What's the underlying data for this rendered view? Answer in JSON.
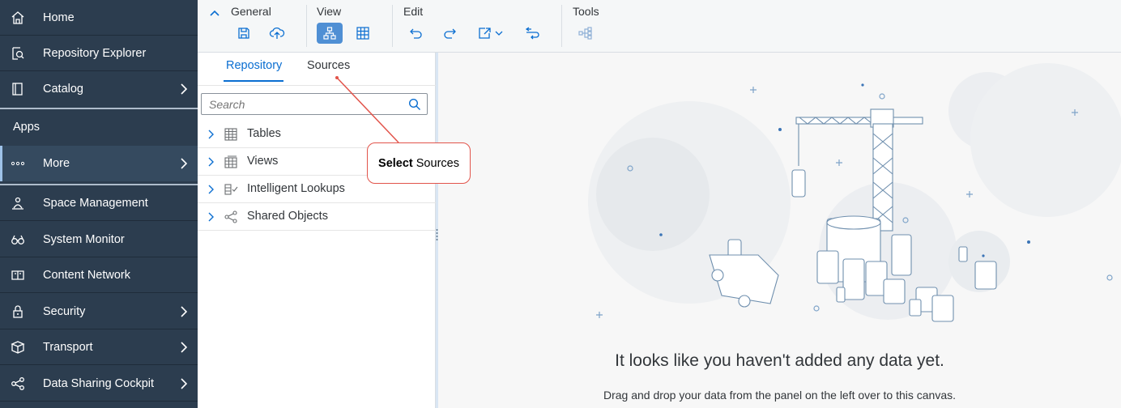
{
  "sidebar": {
    "items": [
      {
        "label": "Home",
        "icon": "home-icon",
        "chevron": false
      },
      {
        "label": "Repository Explorer",
        "icon": "repository-explorer-icon",
        "chevron": false
      },
      {
        "label": "Catalog",
        "icon": "catalog-icon",
        "chevron": true
      }
    ],
    "apps_header": "Apps",
    "apps": [
      {
        "label": "More",
        "icon": "more-icon",
        "chevron": true,
        "active": true
      },
      {
        "label": "Space Management",
        "icon": "space-management-icon",
        "chevron": false
      },
      {
        "label": "System Monitor",
        "icon": "system-monitor-icon",
        "chevron": false
      },
      {
        "label": "Content Network",
        "icon": "content-network-icon",
        "chevron": false
      },
      {
        "label": "Security",
        "icon": "security-icon",
        "chevron": true
      },
      {
        "label": "Transport",
        "icon": "transport-icon",
        "chevron": true
      },
      {
        "label": "Data Sharing Cockpit",
        "icon": "data-sharing-icon",
        "chevron": true
      }
    ]
  },
  "toolbar": {
    "groups": {
      "general": "General",
      "view": "View",
      "edit": "Edit",
      "tools": "Tools"
    }
  },
  "panel": {
    "tabs": [
      {
        "label": "Repository",
        "selected": true
      },
      {
        "label": "Sources",
        "selected": false
      }
    ],
    "search_placeholder": "Search",
    "tree": [
      {
        "label": "Tables",
        "icon": "table-icon"
      },
      {
        "label": "Views",
        "icon": "view-icon"
      },
      {
        "label": "Intelligent Lookups",
        "icon": "intelligent-lookup-icon"
      },
      {
        "label": "Shared Objects",
        "icon": "shared-objects-icon"
      }
    ]
  },
  "canvas": {
    "empty_title": "It looks like you haven't added any data yet.",
    "empty_subtitle": "Drag and drop your data from the panel on the left over to this canvas."
  },
  "callout": {
    "bold": "Select",
    "text": "Sources"
  },
  "colors": {
    "sidebar_bg": "#2c3d4f",
    "accent": "#0a6ed1",
    "callout_border": "#e2544b"
  }
}
